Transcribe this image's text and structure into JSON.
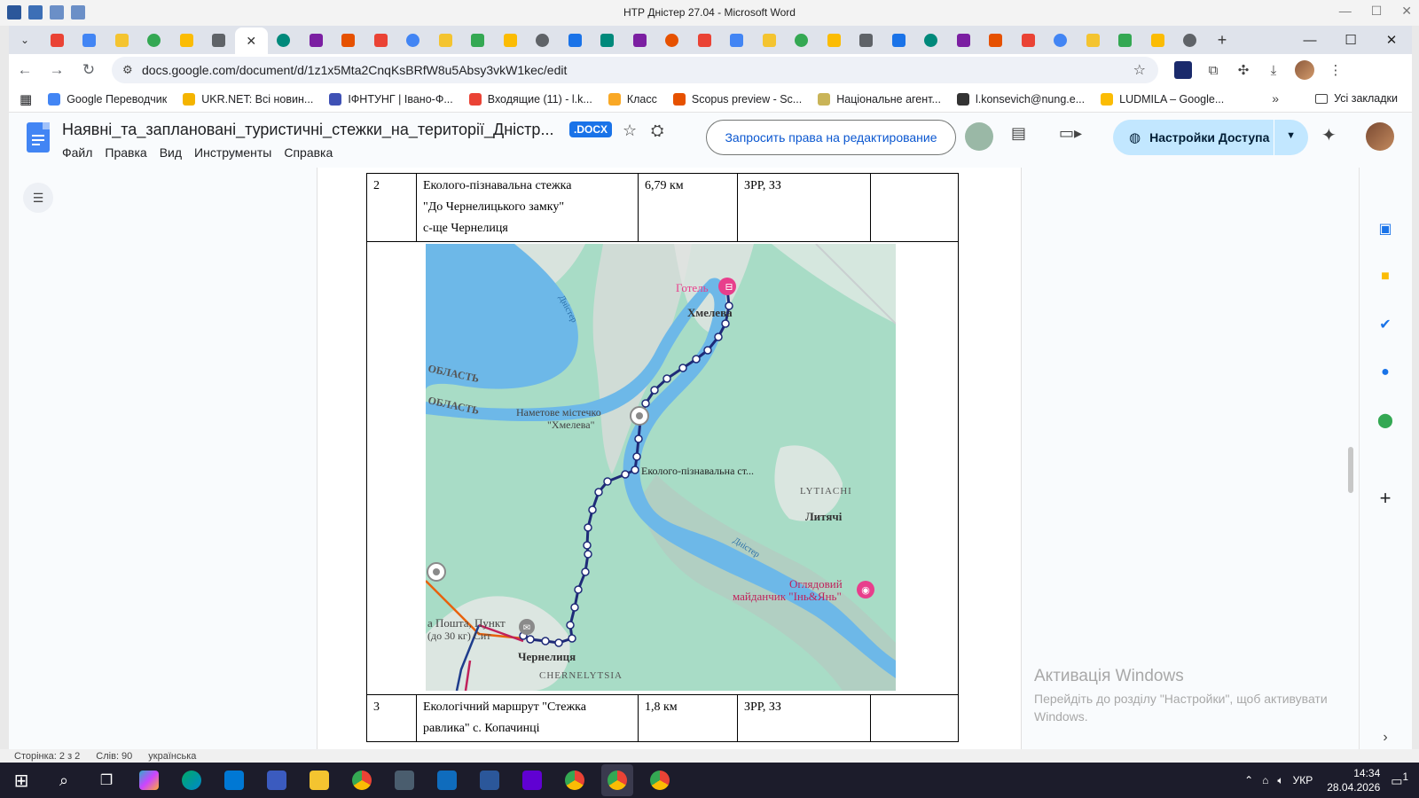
{
  "word": {
    "title": "НТР Дністер 27.04  -  Microsoft Word",
    "status": [
      "Сторінка: 2 з 2",
      "Слів: 90",
      "українська"
    ]
  },
  "chrome": {
    "tab_count": 36,
    "url": "docs.google.com/document/d/1z1x5Mta2CnqKsBRfW8u5Absy3vkW1kec/edit",
    "bookmarks": [
      {
        "label": "Google Переводчик",
        "color": "#4285f4"
      },
      {
        "label": "UKR.NET: Всі новин...",
        "color": "#f4b400"
      },
      {
        "label": "ІФНТУНГ | Івано-Ф...",
        "color": "#3f51b5"
      },
      {
        "label": "Входящие (11) - l.k...",
        "color": "#ea4335"
      },
      {
        "label": "Класс",
        "color": "#f9a825"
      },
      {
        "label": "Scopus preview - Sc...",
        "color": "#e65100"
      },
      {
        "label": "Національне агент...",
        "color": "#c9b458"
      },
      {
        "label": "l.konsevich@nung.e...",
        "color": "#333333"
      },
      {
        "label": "LUDMILA – Google...",
        "color": "#fbbc04"
      }
    ],
    "all_bookmarks": "Усі закладки"
  },
  "docs": {
    "title": "Наявні_та_заплановані_туристичні_стежки_на_території_Дністр...",
    "badge": ".DOCX",
    "menu": [
      "Файл",
      "Правка",
      "Вид",
      "Инструменты",
      "Справка"
    ],
    "request_edit": "Запросить права на редактирование",
    "share": "Настройки Доступа"
  },
  "table": {
    "row2": {
      "num": "2",
      "name": [
        "Еколого-пізнавальна стежка",
        "\"До Чернелицького замку\"",
        "с-ще Чернелиця"
      ],
      "length": "6,79 км",
      "zone": "ЗРР, ЗЗ",
      "extra": ""
    },
    "row3": {
      "num": "3",
      "name": [
        "Екологічний маршрут \"Стежка",
        "равлика\" с. Копачинці"
      ],
      "length": "1,8 км",
      "zone": "ЗРР, ЗЗ",
      "extra": ""
    }
  },
  "map": {
    "labels": {
      "hotel": "Готель",
      "khmeleva": "Хмелева",
      "oblast1": "ОБЛАСТЬ",
      "oblast2": "ОБЛАСТЬ",
      "tent1": "Наметове містечко",
      "tent2": "\"Хмелева\"",
      "trail": "Еколого-пізнавальна ст...",
      "lytiachi_lat": "LYTIACHI",
      "lytiachi": "Литячі",
      "dnister1": "Дністер",
      "dnister2": "Дністер",
      "view1": "Оглядовий",
      "view2": "майданчик \"Інь&Янь\"",
      "post1": "а Пошта, Пункт",
      "post2": "(до 30 кг) Сит",
      "chernelytsia": "Чернелиця",
      "chernelytsia_lat": "CHERNELYTSIA"
    },
    "colors": {
      "land": "#a8dcc6",
      "river": "#6db8e8",
      "route": "#1e2a78",
      "poi": "#e83e8c"
    }
  },
  "overlay": {
    "activate_title": "Активація Windows",
    "activate_text": "Перейдіть до розділу \"Настройки\", щоб активувати Windows."
  },
  "taskbar": {
    "lang": "УКР",
    "time": "14:34",
    "date": "28.04.2026",
    "notif": "1"
  }
}
